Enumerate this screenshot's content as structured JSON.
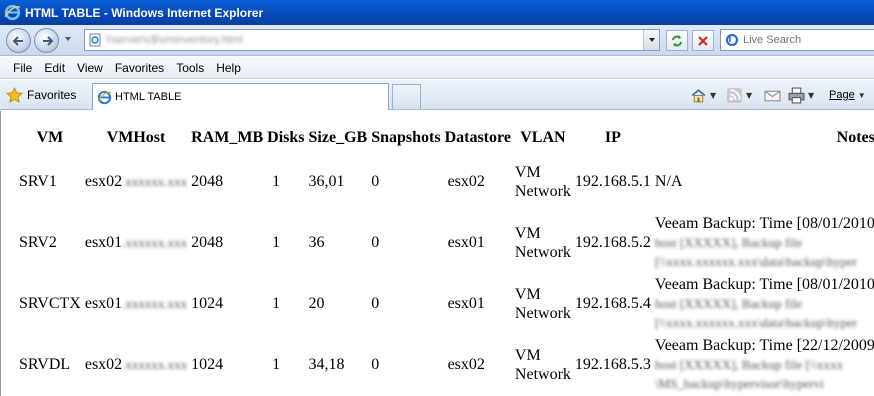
{
  "window": {
    "title": "HTML TABLE - Windows Internet Explorer",
    "accent": "#0548b8"
  },
  "address": {
    "url": "\\\\server\\c$\\vminventory.html",
    "search_placeholder": "Live Search"
  },
  "menu": [
    "File",
    "Edit",
    "View",
    "Favorites",
    "Tools",
    "Help"
  ],
  "favorites": {
    "label": "Favorites",
    "tab_label": "HTML TABLE"
  },
  "commandbar": {
    "page_label": "Page"
  },
  "table": {
    "headers": [
      "VM",
      "VMHost",
      "RAM_MB",
      "Disks",
      "Size_GB",
      "Snapshots",
      "Datastore",
      "VLAN",
      "IP",
      "Notes"
    ],
    "rows": [
      {
        "vm": "SRV1",
        "host": "esx02",
        "host_domain": ".xxxxxx.xxx",
        "ram": "2048",
        "disks": "1",
        "size": "36,01",
        "snapshots": "0",
        "datastore": "esx02",
        "vlan1": "VM",
        "vlan2": "Network",
        "ip": "192.168.5.1",
        "notes": "N/A",
        "notes2": "",
        "notes3": ""
      },
      {
        "vm": "SRV2",
        "host": "esx01",
        "host_domain": ".xxxxxx.xxx",
        "ram": "2048",
        "disks": "1",
        "size": "36",
        "snapshots": "0",
        "datastore": "esx01",
        "vlan1": "VM",
        "vlan2": "Network",
        "ip": "192.168.5.2",
        "notes": "Veeam Backup: Time [08/01/2010",
        "notes2": "host [XXXXX], Backup file",
        "notes3": "[\\\\xxxx.xxxxxx.xxx\\data\\backup\\hyper"
      },
      {
        "vm": "SRVCTX",
        "host": "esx01",
        "host_domain": ".xxxxxx.xxx",
        "ram": "1024",
        "disks": "1",
        "size": "20",
        "snapshots": "0",
        "datastore": "esx01",
        "vlan1": "VM",
        "vlan2": "Network",
        "ip": "192.168.5.4",
        "notes": "Veeam Backup: Time [08/01/2010",
        "notes2": "host [XXXXX], Backup file",
        "notes3": "[\\\\xxxx.xxxxxx.xxx\\data\\backup\\hyper"
      },
      {
        "vm": "SRVDL",
        "host": "esx02",
        "host_domain": ".xxxxxx.xxx",
        "ram": "1024",
        "disks": "1",
        "size": "34,18",
        "snapshots": "0",
        "datastore": "esx02",
        "vlan1": "VM",
        "vlan2": "Network",
        "ip": "192.168.5.3",
        "notes": "Veeam Backup: Time [22/12/2009",
        "notes2": "host [XXXXX], Backup file [\\\\xxxx",
        "notes3": "\\MS_backup\\hypervisor\\hypervi"
      }
    ]
  }
}
